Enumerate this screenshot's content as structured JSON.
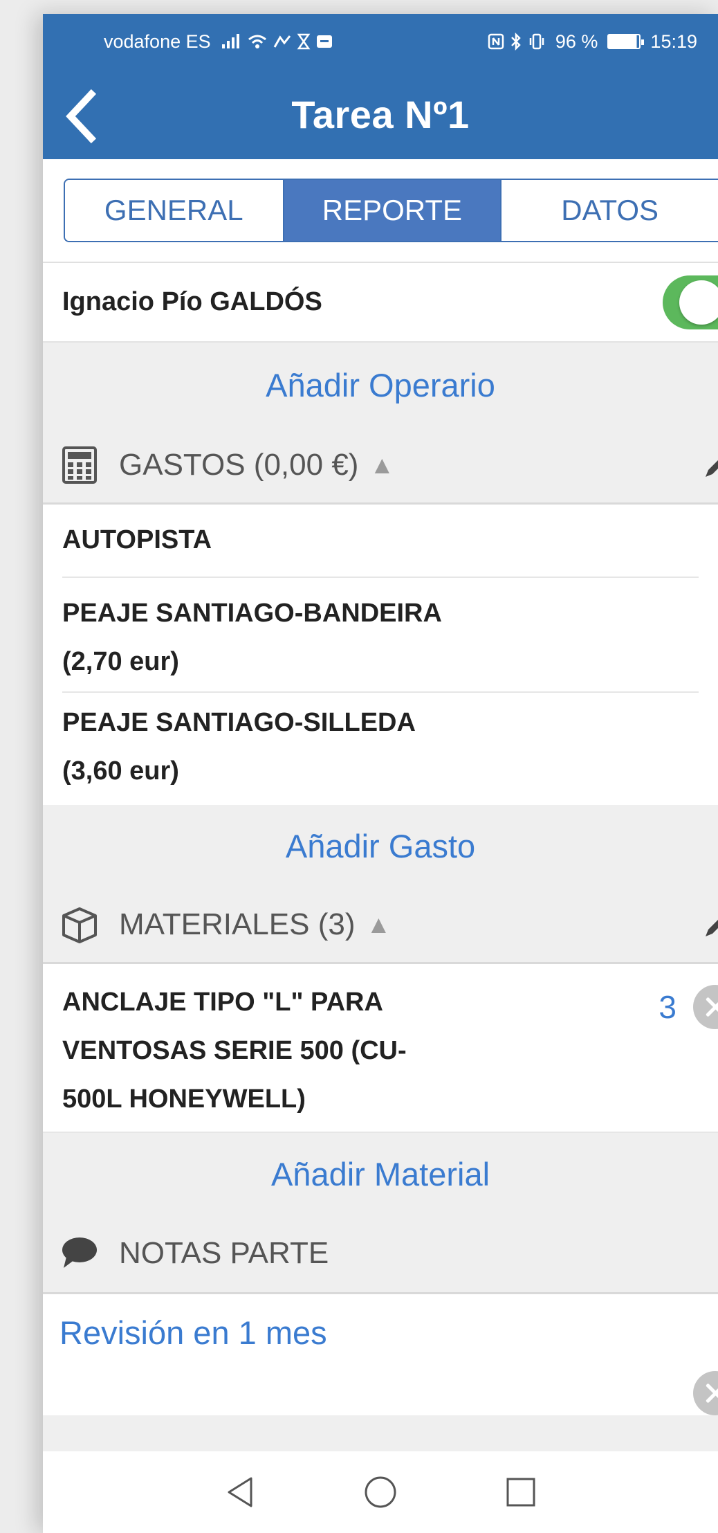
{
  "status_bar": {
    "carrier": "vodafone ES",
    "nfc_battery_text": "96 %",
    "time": "15:19"
  },
  "app_bar": {
    "title": "Tarea Nº1"
  },
  "tabs": [
    {
      "label": "GENERAL",
      "active": false
    },
    {
      "label": "REPORTE",
      "active": true
    },
    {
      "label": "DATOS",
      "active": false
    }
  ],
  "operator": {
    "name": "Ignacio Pío GALDÓS",
    "enabled": true
  },
  "add_operator_label": "Añadir Operario",
  "expenses": {
    "header": "GASTOS (0,00 €)",
    "items": [
      {
        "line1": "AUTOPISTA",
        "line2": ""
      },
      {
        "line1": "PEAJE SANTIAGO-BANDEIRA",
        "line2": "(2,70 eur)"
      },
      {
        "line1": "PEAJE SANTIAGO-SILLEDA",
        "line2": "(3,60 eur)"
      }
    ],
    "add_label": "Añadir Gasto"
  },
  "materials": {
    "header": "MATERIALES (3)",
    "items": [
      {
        "line1": "ANCLAJE TIPO \"L\" PARA",
        "line2": "VENTOSAS SERIE 500 (CU-",
        "line3": "500L HONEYWELL)",
        "quantity": "3"
      }
    ],
    "add_label": "Añadir Material"
  },
  "notes": {
    "header": "NOTAS PARTE",
    "text": "Revisión en 1 mes"
  },
  "colors": {
    "primary": "#3270b2",
    "link": "#3a7bd0",
    "toggle_on": "#5cb85c"
  },
  "icons": [
    "back-arrow-icon",
    "calculator-icon",
    "box-icon",
    "chat-bubble-icon",
    "pencil-icon",
    "close-icon",
    "nav-back-icon",
    "nav-home-icon",
    "nav-recents-icon"
  ]
}
